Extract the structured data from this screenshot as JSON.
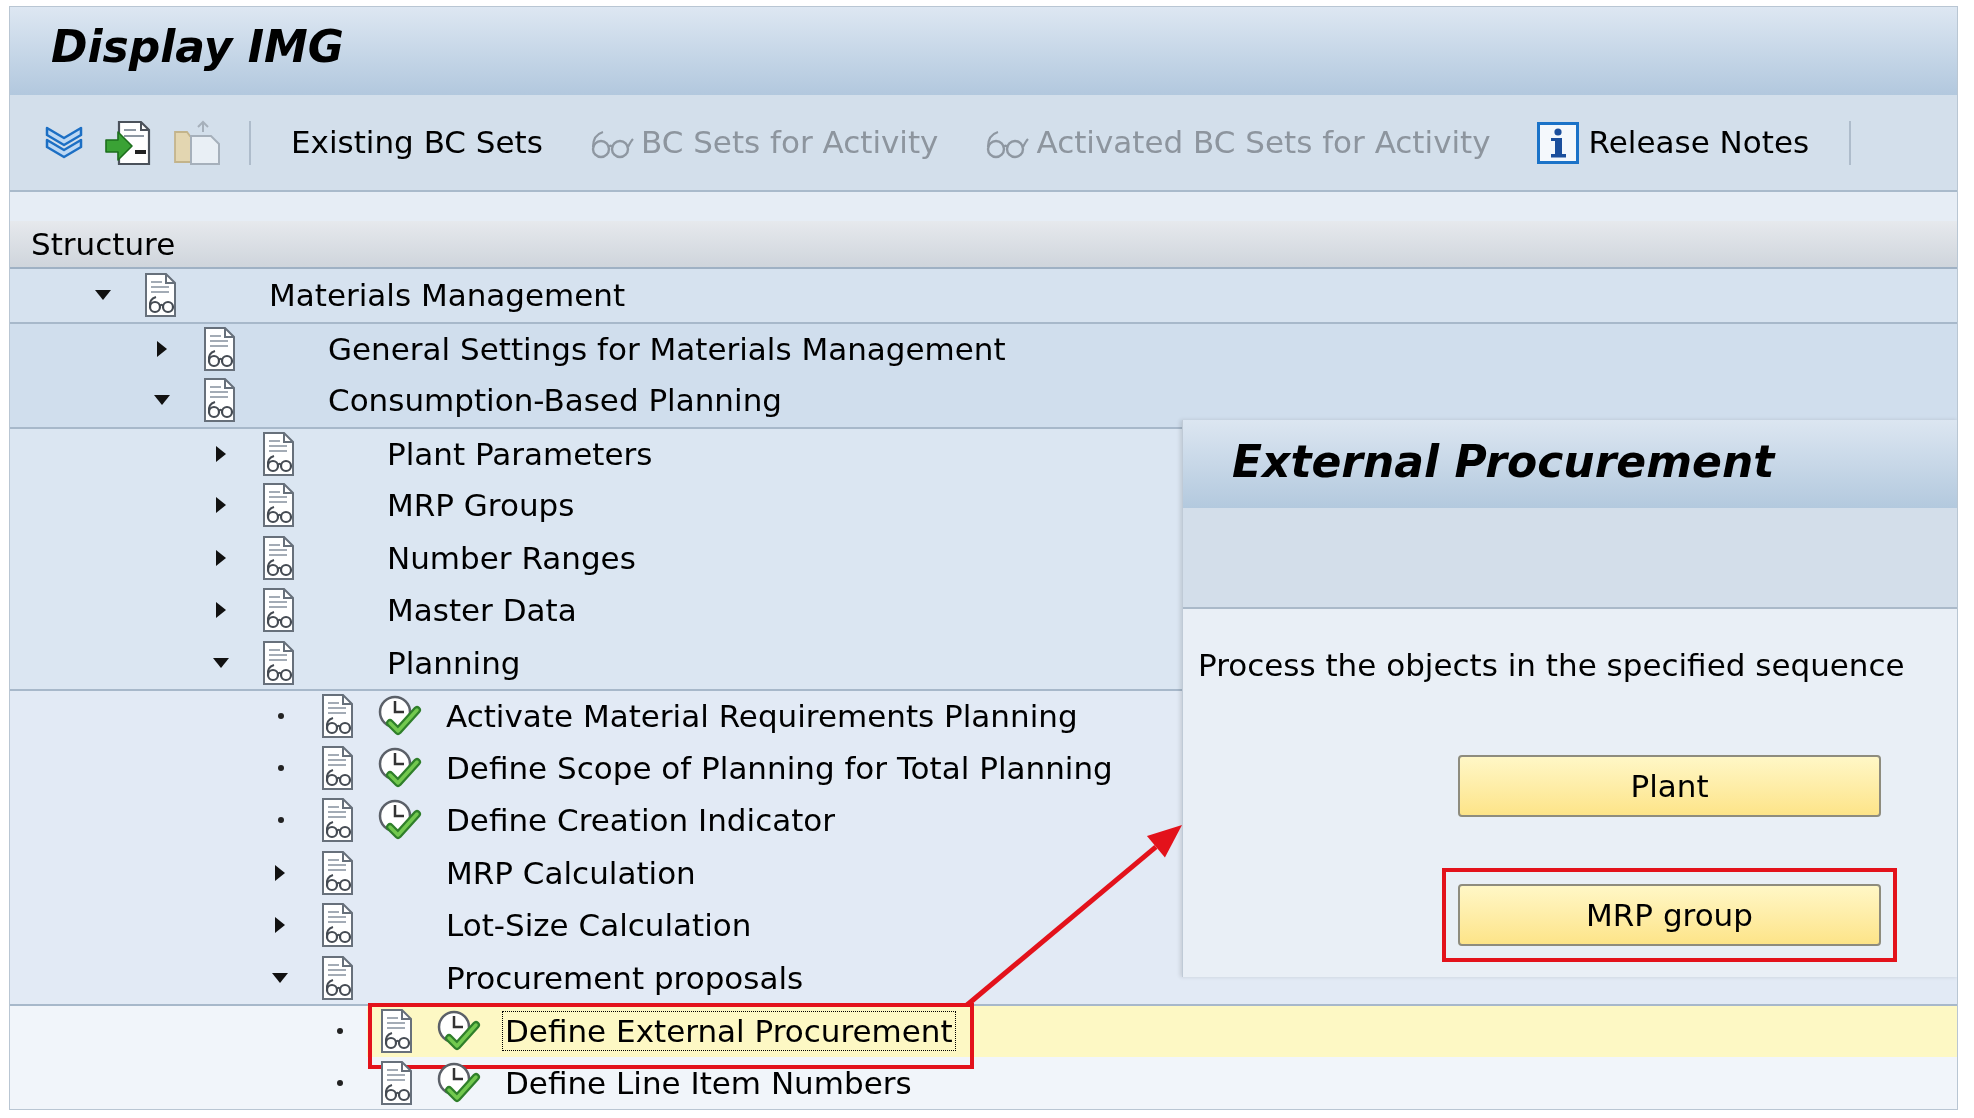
{
  "title": "Display IMG",
  "toolbar": [
    {
      "kind": "expand",
      "disabled": false
    },
    {
      "kind": "import",
      "disabled": false
    },
    {
      "kind": "paste",
      "disabled": true
    },
    {
      "kind": "separator"
    },
    {
      "kind": "text",
      "label": "Existing BC Sets",
      "disabled": false
    },
    {
      "kind": "bc_set",
      "label": "BC Sets for Activity",
      "disabled": true
    },
    {
      "kind": "bc_set",
      "label": "Activated BC Sets for Activity",
      "disabled": true
    },
    {
      "kind": "info",
      "label": "Release Notes",
      "disabled": false
    },
    {
      "kind": "separator"
    }
  ],
  "structure": {
    "header": "Structure",
    "tree": [
      {
        "label": "Materials Management",
        "kind": "folder",
        "expanded": true,
        "selected": false,
        "highlighted": false,
        "children": [
          {
            "label": "General Settings for Materials Management",
            "kind": "folder",
            "expanded": false,
            "selected": false,
            "highlighted": false
          },
          {
            "label": "Consumption-Based Planning",
            "kind": "folder",
            "expanded": true,
            "selected": false,
            "highlighted": false,
            "children": [
              {
                "label": "Plant Parameters",
                "kind": "folder",
                "expanded": false,
                "selected": false,
                "highlighted": false
              },
              {
                "label": "MRP Groups",
                "kind": "folder",
                "expanded": false,
                "selected": false,
                "highlighted": false
              },
              {
                "label": "Number Ranges",
                "kind": "folder",
                "expanded": false,
                "selected": false,
                "highlighted": false
              },
              {
                "label": "Master Data",
                "kind": "folder",
                "expanded": false,
                "selected": false,
                "highlighted": false
              },
              {
                "label": "Planning",
                "kind": "folder",
                "expanded": true,
                "selected": false,
                "highlighted": false,
                "children": [
                  {
                    "label": "Activate Material Requirements Planning",
                    "kind": "activity",
                    "selected": false,
                    "highlighted": false
                  },
                  {
                    "label": "Define Scope of Planning for Total Planning",
                    "kind": "activity",
                    "selected": false,
                    "highlighted": false
                  },
                  {
                    "label": "Define Creation Indicator",
                    "kind": "activity",
                    "selected": false,
                    "highlighted": false
                  },
                  {
                    "label": "MRP Calculation",
                    "kind": "folder",
                    "expanded": false,
                    "selected": false,
                    "highlighted": false
                  },
                  {
                    "label": "Lot-Size Calculation",
                    "kind": "folder",
                    "expanded": false,
                    "selected": false,
                    "highlighted": false
                  },
                  {
                    "label": "Procurement proposals",
                    "kind": "folder",
                    "expanded": true,
                    "selected": false,
                    "highlighted": false,
                    "children": [
                      {
                        "label": "Define External Procurement",
                        "kind": "activity",
                        "selected": true,
                        "highlighted": true
                      },
                      {
                        "label": "Define Line Item Numbers",
                        "kind": "activity",
                        "selected": false,
                        "highlighted": false
                      }
                    ]
                  }
                ]
              }
            ]
          }
        ]
      }
    ]
  },
  "popup": {
    "title": "External Procurement",
    "message": "Process the objects in the specified sequence",
    "buttons": [
      {
        "label": "Plant",
        "highlighted": false
      },
      {
        "label": "MRP group",
        "highlighted": true
      }
    ]
  }
}
